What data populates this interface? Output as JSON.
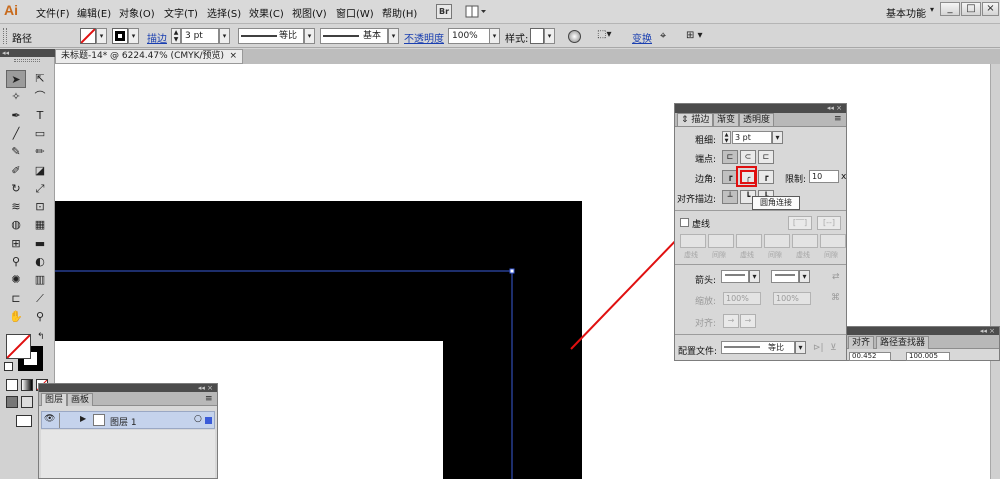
{
  "app": {
    "logo": "Ai",
    "workspace": "基本功能"
  },
  "menu": {
    "items": [
      "文件(F)",
      "编辑(E)",
      "对象(O)",
      "文字(T)",
      "选择(S)",
      "效果(C)",
      "视图(V)",
      "窗口(W)",
      "帮助(H)"
    ],
    "bridge_icon": "Br",
    "window_buttons": [
      "_",
      "□",
      "×"
    ]
  },
  "controlbar": {
    "object_type": "路径",
    "stroke_link": "描边",
    "stroke_weight": "3 pt",
    "profile_label": "等比",
    "brush_label": "基本",
    "opacity_link": "不透明度",
    "opacity_value": "100%",
    "style_label": "样式:",
    "transform_link": "变换"
  },
  "document": {
    "tab_title": "未标题-14* @ 6224.47% (CMYK/预览)",
    "close": "×"
  },
  "tools": {
    "rows": [
      [
        "selection-arrow",
        "direct-selection-arrow"
      ],
      [
        "magic-wand",
        "lasso"
      ],
      [
        "pen",
        "type"
      ],
      [
        "line-segment",
        "rectangle"
      ],
      [
        "paintbrush",
        "pencil"
      ],
      [
        "blob-brush",
        "eraser"
      ],
      [
        "rotate",
        "scale"
      ],
      [
        "warp",
        "free-transform"
      ],
      [
        "shape-builder",
        "perspective-grid"
      ],
      [
        "mesh",
        "gradient"
      ],
      [
        "eyedropper",
        "blend"
      ],
      [
        "symbol-sprayer",
        "column-graph"
      ],
      [
        "artboard",
        "slice"
      ],
      [
        "hand",
        "zoom"
      ]
    ]
  },
  "stroke_panel": {
    "tabs": [
      "描边",
      "渐变",
      "透明度"
    ],
    "weight_label": "粗细:",
    "weight_value": "3 pt",
    "cap_label": "端点:",
    "corner_label": "边角:",
    "limit_label": "限制:",
    "limit_value": "10",
    "limit_unit": "x",
    "align_label": "对齐描边:",
    "dashed_label": "虚线",
    "dash_labels": [
      "虚线",
      "间隙",
      "虚线",
      "间隙",
      "虚线",
      "间隙"
    ],
    "arrow_label": "箭头:",
    "scale_label": "缩放:",
    "scale_value_1": "100%",
    "scale_value_2": "100%",
    "align_arrow_label": "对齐:",
    "profile_label": "配置文件:",
    "profile_value": "等比",
    "tooltip": "圆角连接"
  },
  "align_panel": {
    "tabs": [
      "对齐",
      "路径查找器"
    ],
    "x_value": "00.452",
    "w_value": "100.005"
  },
  "layers_panel": {
    "tabs": [
      "图层",
      "画板"
    ],
    "layer_name": "图层 1"
  },
  "colors": {
    "accent_red": "#e01010",
    "selection_blue": "#3a5bd8",
    "shape_black": "#000000"
  }
}
